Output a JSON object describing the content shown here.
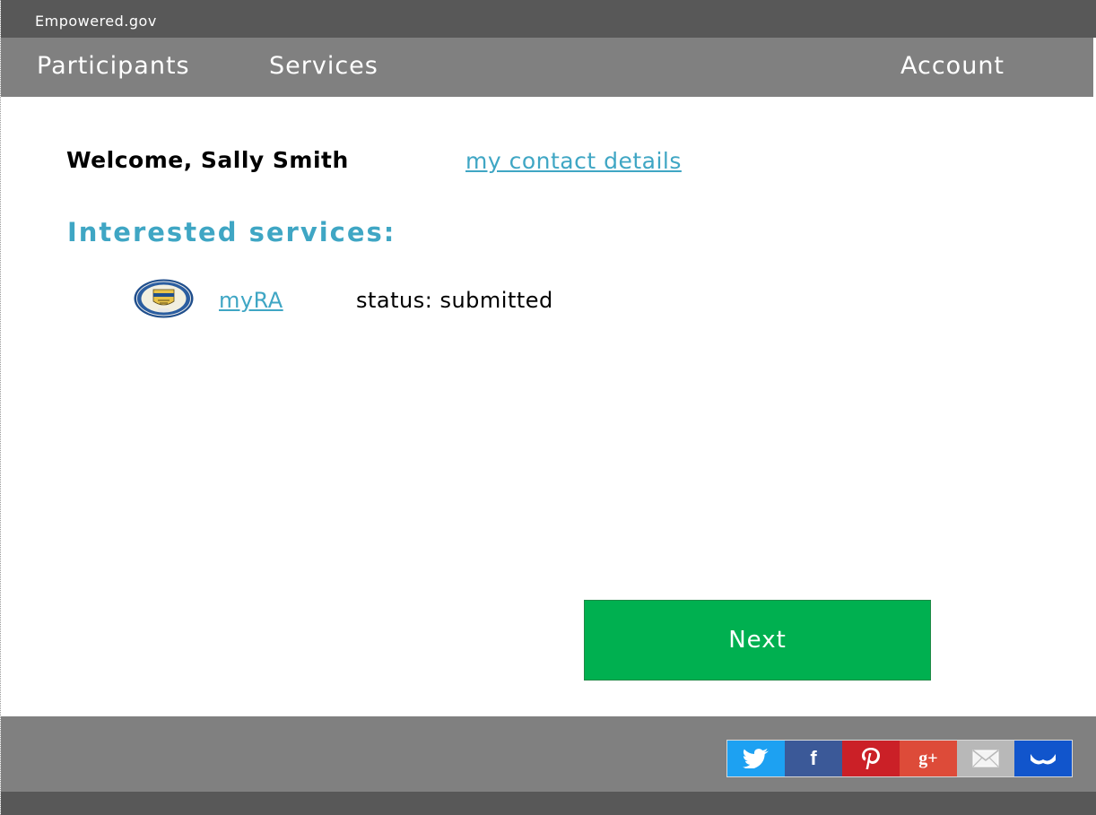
{
  "app": {
    "brand": "Empowered.gov"
  },
  "nav": {
    "participants": "Participants",
    "services": "Services",
    "account": "Account"
  },
  "main": {
    "welcome": "Welcome, Sally Smith",
    "contact_link": "my contact details",
    "section_heading": "Interested services:",
    "services": [
      {
        "name": "myRA",
        "status": "status: submitted",
        "icon": "treasury-seal-icon"
      }
    ],
    "next_label": "Next"
  },
  "footer": {
    "share_buttons": [
      {
        "name": "twitter",
        "icon": "twitter-icon",
        "color": "#1da1f2"
      },
      {
        "name": "facebook",
        "icon": "facebook-icon",
        "color": "#3b5998"
      },
      {
        "name": "pinterest",
        "icon": "pinterest-icon",
        "color": "#cb2027"
      },
      {
        "name": "google-plus",
        "icon": "google-plus-icon",
        "color": "#dd4b39"
      },
      {
        "name": "email",
        "icon": "email-icon",
        "color": "#b8b8b8"
      },
      {
        "name": "bookmark",
        "icon": "crown-icon",
        "color": "#1155cc"
      }
    ]
  },
  "colors": {
    "topbar": "#585858",
    "navbar": "#808080",
    "accent": "#3fa6c4",
    "next_button": "#00b050"
  }
}
